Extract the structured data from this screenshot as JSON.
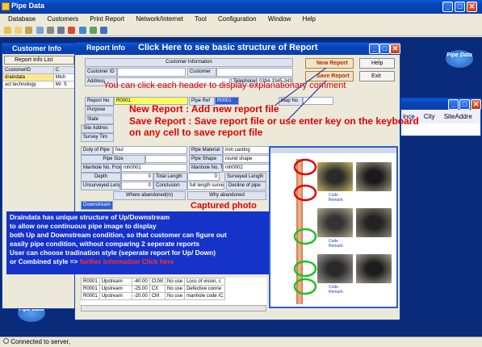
{
  "app": {
    "title": "Pipe Data"
  },
  "menu": [
    "Database",
    "Customers",
    "Print Report",
    "Network/Internet",
    "Tool",
    "Configuration",
    "Window",
    "Help"
  ],
  "customer_info": {
    "title": "Customer Info",
    "tab_label": "Report Info List",
    "columns": [
      "CustomerID",
      "C"
    ],
    "rows": [
      [
        "draindata",
        "Mich"
      ],
      [
        "act technology",
        "Mr. S"
      ]
    ]
  },
  "report_info": {
    "title": "Report Info",
    "banner": "Click Here to see basic structure of Report",
    "buttons": {
      "new_report": "New Report",
      "save_report": "Save Report",
      "help": "Help",
      "exit": "Exit"
    },
    "customer_information": "Customer Information",
    "labels": {
      "customer_id": "Customer ID",
      "customer": "Customer",
      "address": "Address",
      "telephone": "Telephone",
      "report_no": "Report No",
      "pipe_ref": "Pipe Ref",
      "map_no": "Map No",
      "purpose": "Purpose",
      "state": "State",
      "site_address": "Site Addres",
      "survey_time": "Survey Tim",
      "duty_of_pipe": "Duty of Pipe",
      "pipe_material": "Pipe Material",
      "pipe_size": "Pipe Size",
      "pipe_shape": "Pipe Shape",
      "manhole_from": "Manhole No. From",
      "manhole_to": "Manhole No. To",
      "depth": "Depth",
      "total_length": "Total Length",
      "surveyed_length": "Surveyed Length",
      "unsurveyed_length": "Unsurveyed Length",
      "conclusion": "Conclusion",
      "where_abandoned": "Where abandoned(m)",
      "why_abandoned": "Why abandoned",
      "downstream": "Downstream"
    },
    "values": {
      "telephone": "0394-3345-3433",
      "report_no": "R0001",
      "pipe_ref": "R0001",
      "duty_of_pipe": "foul",
      "pipe_material": "iron casting",
      "pipe_shape": "round shape",
      "manhole_from": "mh0001",
      "manhole_to": "mh0002",
      "depth": "0",
      "total_length": "0",
      "surveyed_length": "0",
      "unsurveyed_length": "0",
      "conclusion": "full length survey",
      "decline": "Decline of pipe"
    }
  },
  "annotations": {
    "header_hint": "You can click each header to display explanationary comment",
    "new_report": "New Report : Add new report file",
    "save_report": "Save Report : Save report file or use enter key on the keyboard",
    "save_report2": "on any cell to save report file",
    "captured_photo": "Captured photo",
    "info_lines": [
      "Draindata has unique structure of Up/Downstream",
      "to allow one continuous pipe image to display",
      "both Up and Downstream condition, so that customer can figure out",
      "easily pipe condition, without comparing 2 seperate reports",
      "User can choose tradination style (seperate report for Up/ Down)"
    ],
    "info_last_prefix": "or Combined style => ",
    "info_last_link": "further information Click here"
  },
  "back_window": {
    "columns": [
      "ince",
      "City",
      "SiteAddre"
    ]
  },
  "observations": {
    "rows": [
      [
        "R0001",
        "Upstream",
        "-40.00",
        "CUW",
        "No use",
        "Loss of vision, c"
      ],
      [
        "R0001",
        "Upstream",
        "-25.00",
        "CX",
        "No use",
        "Defective conne"
      ],
      [
        "R0001",
        "Upstream",
        "-20.00",
        "CM",
        "No use",
        "manhole code /C"
      ]
    ]
  },
  "photo_panel": {
    "labels": [
      "Code :",
      "Remark:"
    ]
  },
  "status": {
    "text": "Connected to server,"
  },
  "logo_text": "Pipe Data"
}
